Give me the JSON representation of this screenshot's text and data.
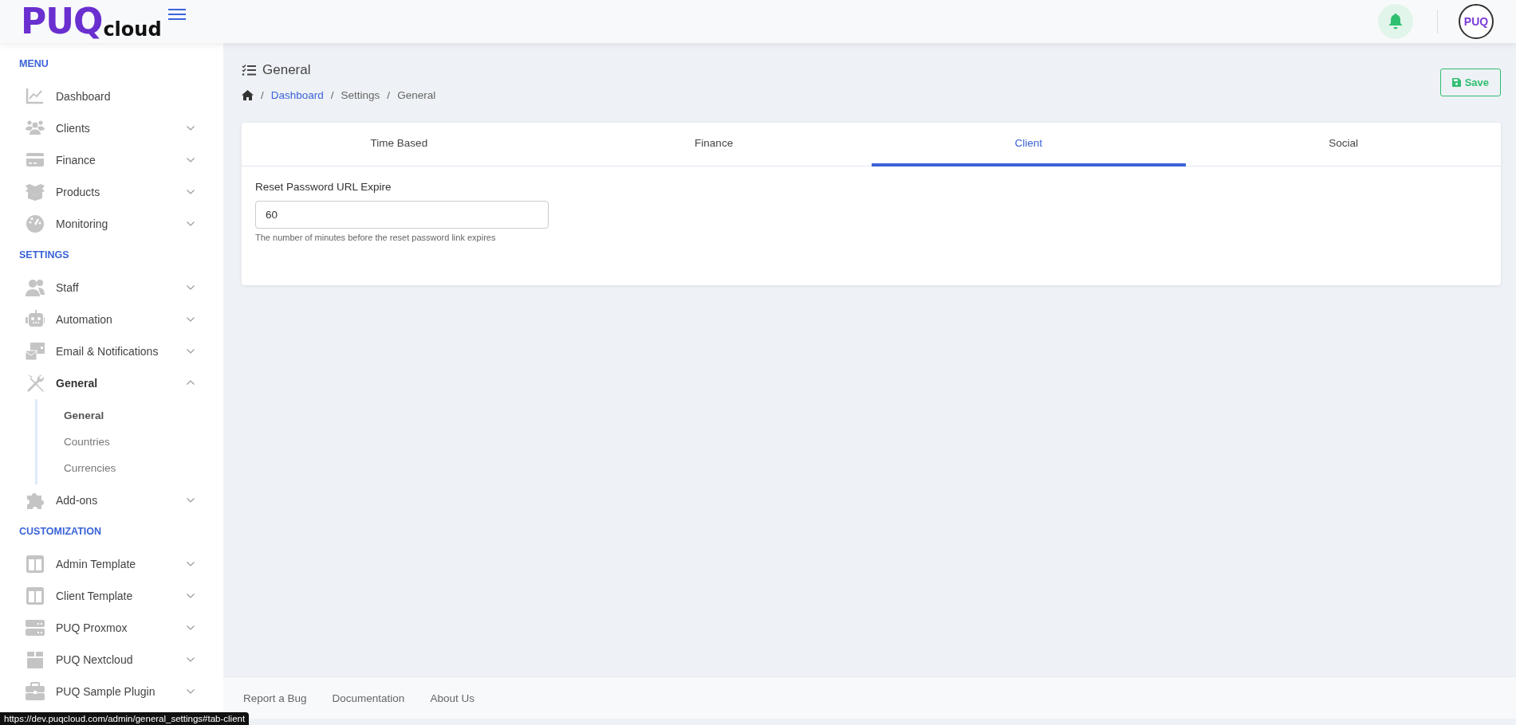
{
  "header": {
    "logo_main": "PUQ",
    "logo_sub": "cloud",
    "avatar": "PUQ"
  },
  "sidebar": {
    "sections": [
      {
        "title": "MENU",
        "items": [
          {
            "label": "Dashboard",
            "expandable": false,
            "expanded": false,
            "selected": false
          },
          {
            "label": "Clients",
            "expandable": true,
            "expanded": false,
            "selected": false
          },
          {
            "label": "Finance",
            "expandable": true,
            "expanded": false,
            "selected": false
          },
          {
            "label": "Products",
            "expandable": true,
            "expanded": false,
            "selected": false
          },
          {
            "label": "Monitoring",
            "expandable": true,
            "expanded": false,
            "selected": false
          }
        ]
      },
      {
        "title": "SETTINGS",
        "items": [
          {
            "label": "Staff",
            "expandable": true,
            "expanded": false,
            "selected": false
          },
          {
            "label": "Automation",
            "expandable": true,
            "expanded": false,
            "selected": false
          },
          {
            "label": "Email & Notifications",
            "expandable": true,
            "expanded": false,
            "selected": false
          },
          {
            "label": "General",
            "expandable": true,
            "expanded": true,
            "selected": true,
            "children": [
              {
                "label": "General",
                "selected": true
              },
              {
                "label": "Countries",
                "selected": false
              },
              {
                "label": "Currencies",
                "selected": false
              }
            ]
          },
          {
            "label": "Add-ons",
            "expandable": true,
            "expanded": false,
            "selected": false
          }
        ]
      },
      {
        "title": "CUSTOMIZATION",
        "items": [
          {
            "label": "Admin Template",
            "expandable": true,
            "expanded": false,
            "selected": false
          },
          {
            "label": "Client Template",
            "expandable": true,
            "expanded": false,
            "selected": false
          },
          {
            "label": "PUQ Proxmox",
            "expandable": true,
            "expanded": false,
            "selected": false
          },
          {
            "label": "PUQ Nextcloud",
            "expandable": true,
            "expanded": false,
            "selected": false
          },
          {
            "label": "PUQ Sample Plugin",
            "expandable": true,
            "expanded": false,
            "selected": false
          }
        ]
      }
    ]
  },
  "page": {
    "title": "General",
    "separator": "/",
    "breadcrumb": [
      {
        "label": "Dashboard",
        "link": true
      },
      {
        "label": "Settings",
        "link": false
      },
      {
        "label": "General",
        "link": false
      }
    ],
    "save_button": "Save"
  },
  "tabs": [
    {
      "label": "Time Based",
      "selected": false
    },
    {
      "label": "Finance",
      "selected": false
    },
    {
      "label": "Client",
      "selected": true
    },
    {
      "label": "Social",
      "selected": false
    }
  ],
  "form": {
    "label": "Reset Password URL Expire",
    "value": "60",
    "help": "The number of minutes before the reset password link expires"
  },
  "footer": {
    "links": [
      "Report a Bug",
      "Documentation",
      "About Us"
    ]
  },
  "status_bar": {
    "url": "https://dev.puqcloud.com/admin/general_settings#tab-client"
  }
}
